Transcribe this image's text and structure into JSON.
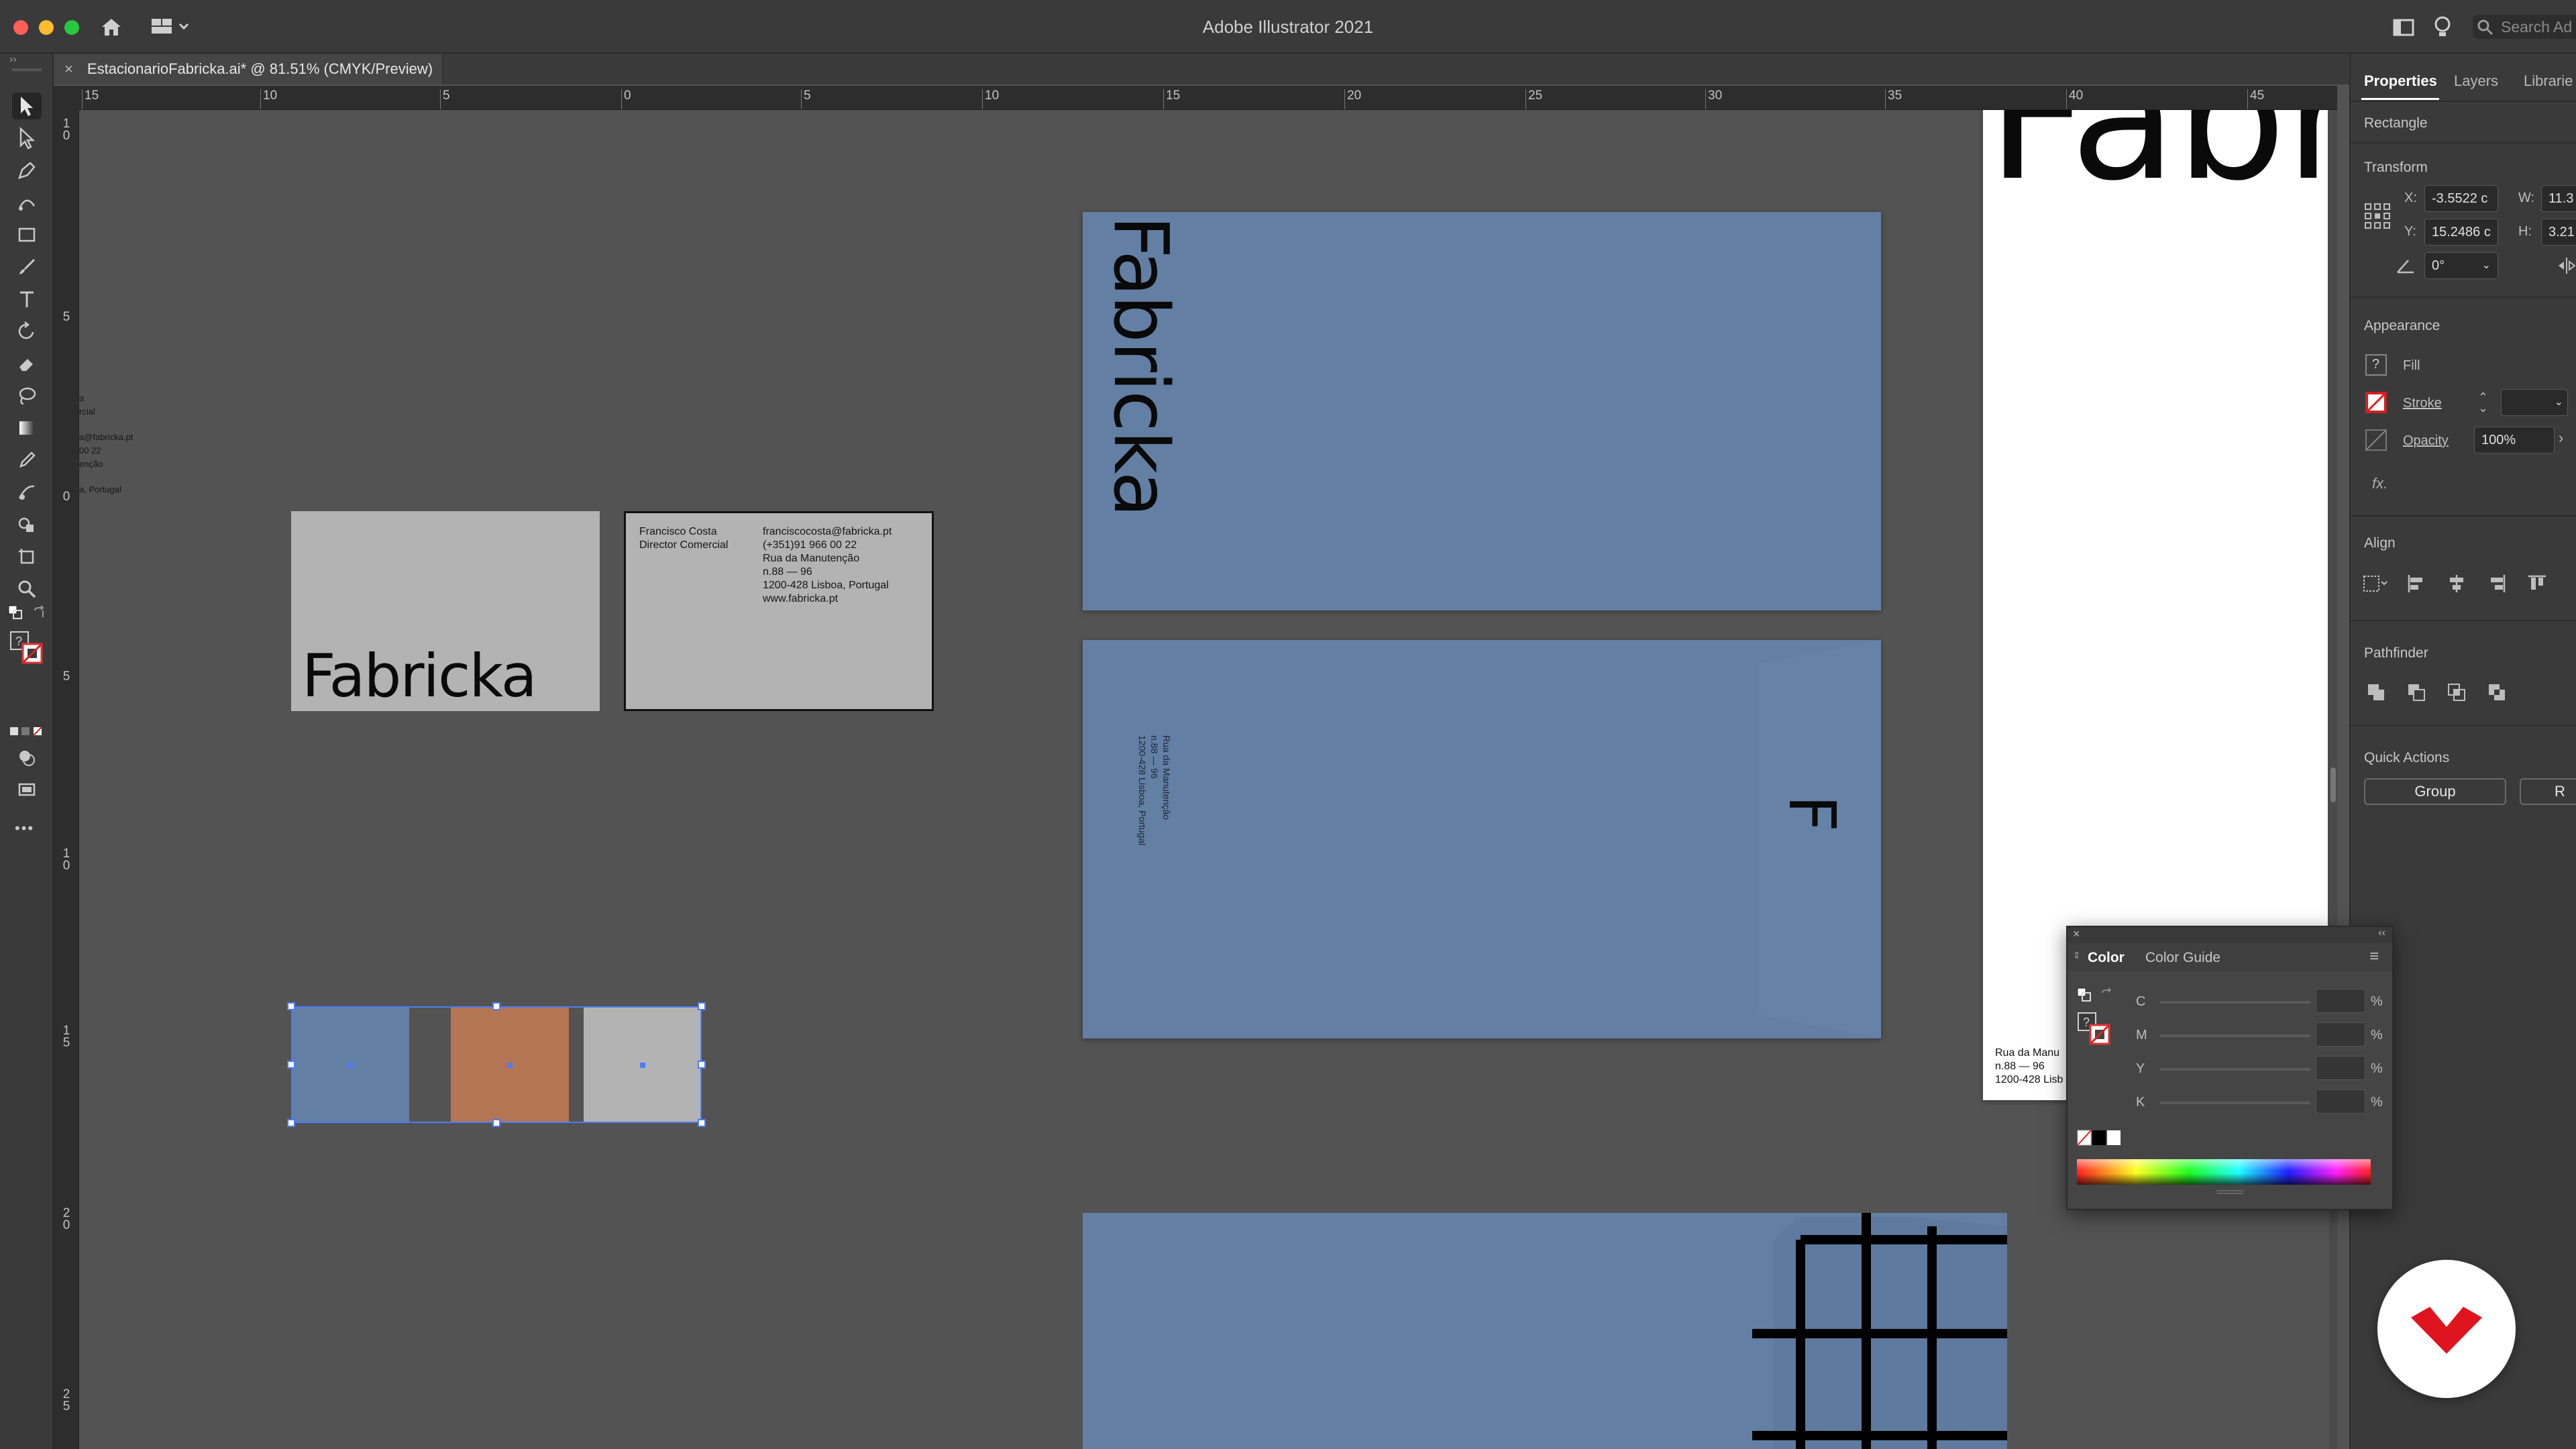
{
  "app": {
    "title": "Adobe Illustrator 2021",
    "search_placeholder": "Search Ad",
    "traffic_colors": [
      "#fe5f57",
      "#febc2e",
      "#28c840"
    ]
  },
  "document_tab": {
    "close": "×",
    "label": "EstacionarioFabricka.ai* @ 81.51% (CMYK/Preview)"
  },
  "ruler_top": [
    "15",
    "10",
    "5",
    "0",
    "5",
    "10",
    "15",
    "20",
    "25",
    "30",
    "35",
    "40",
    "45"
  ],
  "ruler_left": [
    "1\n0",
    "5",
    "0",
    "5",
    "1\n0",
    "1\n5",
    "2\n0",
    "2\n5"
  ],
  "toolbar": {
    "icons": [
      "selection-icon",
      "direct-selection-icon",
      "pen-icon",
      "curvature-icon",
      "rectangle-icon",
      "paintbrush-icon",
      "type-icon",
      "rotate-icon",
      "eraser-icon",
      "lasso-icon",
      "gradient-icon",
      "eyedropper-icon",
      "blend-icon",
      "shape-builder-icon",
      "artboard-icon",
      "zoom-icon"
    ],
    "more": "•••"
  },
  "canvas": {
    "brand": "Fabricka",
    "brand_initial": "F",
    "business_card": {
      "name": "Francisco Costa",
      "role": "Director Comercial",
      "email": "franciscocosta@fabricka.pt",
      "phone": "(+351)91 966 00 22",
      "street": "Rua da Manutenção",
      "number": "n.88 — 96",
      "city": "1200-428 Lisboa, Portugal",
      "web": "www.fabricka.pt"
    },
    "envelope_address": [
      "Rua da Manutenção",
      "n.88 — 96",
      "1200-428 Lisboa, Portugal"
    ],
    "letter_address": [
      "Rua da Manu",
      "n.88 — 96",
      "1200-428 Lisb"
    ],
    "left_fragments": [
      "a",
      "rcial",
      "a@fabricka.pt",
      "00 22",
      "enção",
      "a, Portugal"
    ],
    "swatches": [
      "#637fa3",
      "#b47554",
      "#b3b3b3"
    ]
  },
  "panel": {
    "tabs": [
      "Properties",
      "Layers",
      "Librarie"
    ],
    "object_type": "Rectangle",
    "transform": {
      "title": "Transform",
      "x_label": "X:",
      "x_value": "-3.5522 c",
      "y_label": "Y:",
      "y_value": "15.2486 c",
      "w_label": "W:",
      "w_value": "11.3",
      "h_label": "H:",
      "h_value": "3.21",
      "rotate_value": "0°"
    },
    "appearance": {
      "title": "Appearance",
      "fill": "Fill",
      "stroke": "Stroke",
      "opacity": "Opacity",
      "opacity_value": "100%",
      "fx": "fx."
    },
    "align": {
      "title": "Align"
    },
    "pathfinder": {
      "title": "Pathfinder"
    },
    "quick_actions": {
      "title": "Quick Actions",
      "group": "Group",
      "second": "R"
    }
  },
  "color_panel": {
    "tabs": [
      "Color",
      "Color Guide"
    ],
    "channels": [
      "C",
      "M",
      "Y",
      "K"
    ],
    "pct": "%"
  }
}
